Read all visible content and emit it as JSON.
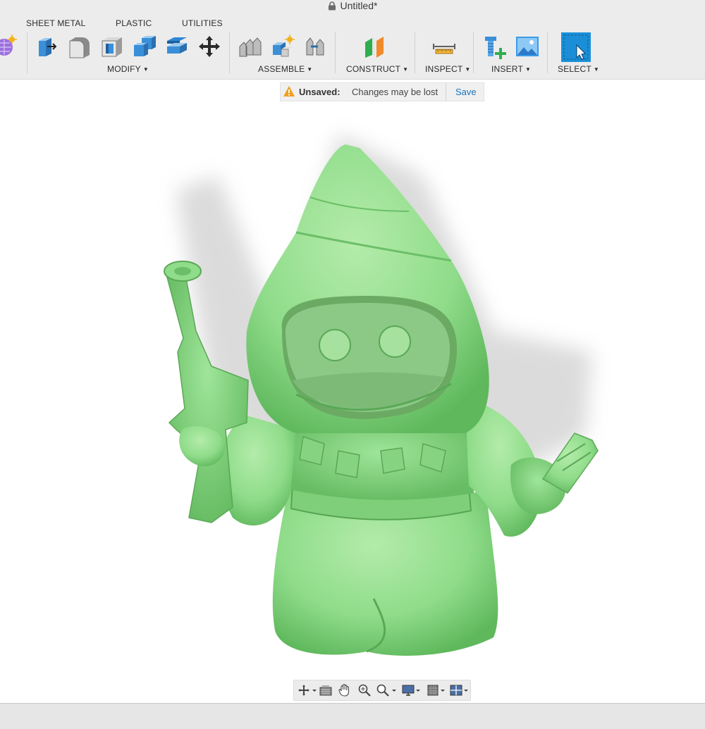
{
  "window": {
    "title": "Untitled*",
    "lock_icon": "lock-icon"
  },
  "tabs": [
    "SHEET METAL",
    "PLASTIC",
    "UTILITIES"
  ],
  "groups": {
    "modify": "MODIFY",
    "assemble": "ASSEMBLE",
    "construct": "CONSTRUCT",
    "inspect": "INSPECT",
    "insert": "INSERT",
    "select": "SELECT"
  },
  "tools": {
    "create_form": "create-form-icon",
    "press_pull": "press-pull-icon",
    "fillet": "fillet-icon",
    "shell": "shell-icon",
    "combine": "combine-icon",
    "offset_face": "offset-face-icon",
    "move_copy": "move-copy-icon",
    "new_component": "new-component-icon",
    "joint": "joint-icon",
    "as_built_joint": "as-built-joint-icon",
    "offset_plane": "offset-plane-icon",
    "measure": "measure-icon",
    "insert_mcmaster": "insert-mcmaster-icon",
    "insert_canvas": "insert-canvas-icon",
    "select": "select-icon"
  },
  "banner": {
    "label": "Unsaved:",
    "message": "Changes may be lost",
    "save": "Save"
  },
  "colors": {
    "accent": "#1a73b8",
    "model": "#8fdc8a",
    "warning": "#f0a020"
  },
  "navbar": [
    "orbit-icon",
    "look-at-icon",
    "pan-icon",
    "zoom-icon",
    "fit-icon",
    "display-settings-icon",
    "grid-settings-icon",
    "viewports-icon"
  ]
}
